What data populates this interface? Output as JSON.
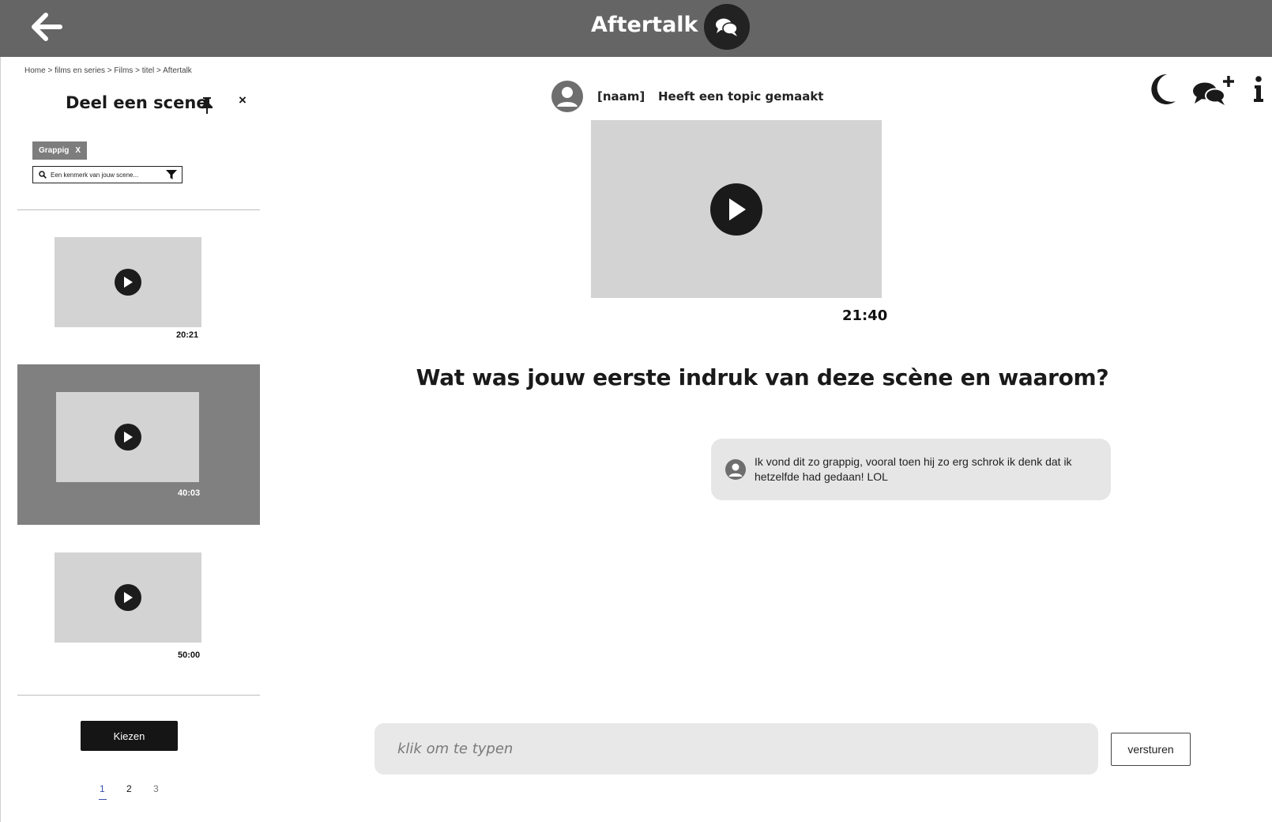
{
  "header": {
    "title": "Aftertalk",
    "back_icon": "arrow-left-icon",
    "title_icon": "chat-bubbles-icon",
    "background": "#666566"
  },
  "breadcrumb": {
    "items": [
      "Home",
      "films en series",
      "Films",
      "titel",
      "Aftertalk"
    ],
    "separator": ">"
  },
  "share_panel": {
    "title": "Deel een scene",
    "pin_icon": "pin-icon",
    "close_label": "×",
    "filter_chip": {
      "label": "Grappig",
      "remove_label": "X"
    },
    "search": {
      "placeholder": "Een kenmerk van jouw scene...",
      "value": ""
    },
    "scenes": [
      {
        "duration": "20:21",
        "selected": false
      },
      {
        "duration": "40:03",
        "selected": true
      },
      {
        "duration": "50:00",
        "selected": false
      }
    ],
    "choose_label": "Kiezen",
    "pagination": [
      "1",
      "2",
      "3"
    ],
    "current_page": "1"
  },
  "topic": {
    "author": "[naam]",
    "action": "Heeft een topic gemaakt",
    "video_timestamp": "21:40",
    "question": "Wat was jouw eerste indruk van deze scène en waarom?"
  },
  "messages": [
    {
      "text": "Ik vond dit zo grappig, vooral toen hij zo erg schrok ik denk dat ik hetzelfde had gedaan! LOL"
    }
  ],
  "composer": {
    "placeholder": "klik om te typen",
    "value": "",
    "send_label": "versturen"
  },
  "tools": [
    "moon-icon",
    "new-chat-icon",
    "info-icon"
  ],
  "colors": {
    "header": "#666566",
    "selected_scene": "#808080",
    "thumbnail": "#d3d3d3",
    "bubble": "#e6e6e6",
    "active_page": "#3a4fb0"
  }
}
